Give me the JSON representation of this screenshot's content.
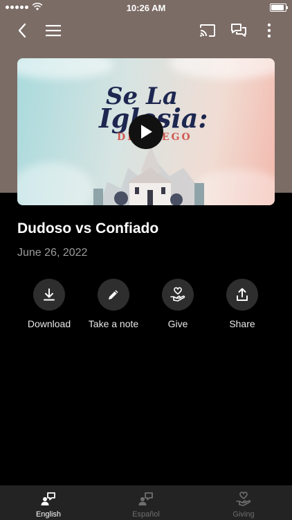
{
  "status_bar": {
    "time": "10:26 AM"
  },
  "video": {
    "art_title_line1": "Se La",
    "art_title_line2": "Iglesia:",
    "art_subtitle": "DE FUEGO"
  },
  "sermon": {
    "title": "Dudoso vs Confiado",
    "date": "June 26, 2022"
  },
  "actions": [
    {
      "label": "Download",
      "icon": "download-icon"
    },
    {
      "label": "Take a note",
      "icon": "pencil-icon"
    },
    {
      "label": "Give",
      "icon": "heart-hand-icon"
    },
    {
      "label": "Share",
      "icon": "share-icon"
    }
  ],
  "tabs": [
    {
      "label": "English",
      "icon": "translate-icon",
      "active": true
    },
    {
      "label": "Español",
      "icon": "translate-icon",
      "active": false
    },
    {
      "label": "Giving",
      "icon": "heart-hand-icon",
      "active": false
    }
  ],
  "colors": {
    "hero_bg": "#7c6c66",
    "button_bg": "#2e2e2e",
    "tabbar_bg": "#232323"
  },
  "battery_level": 1.0
}
